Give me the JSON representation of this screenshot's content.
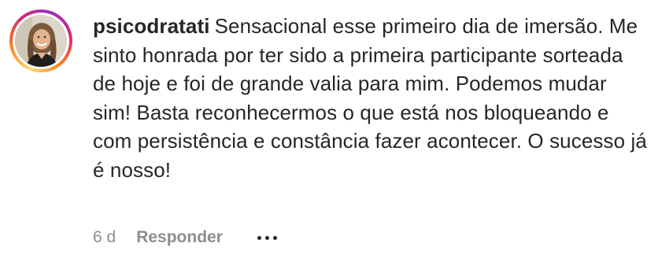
{
  "comment": {
    "username": "psicodratati",
    "text": "Sensacional esse primeiro dia de imersão. Me sinto honrada por ter sido a primeira participante sorteada de hoje e foi de grande valia para mim. Podemos mudar sim! Basta reconhecermos o que está nos bloqueando e com persistência e constância fazer acontecer. O sucesso já é nosso!",
    "time": "6 d",
    "reply_label": "Responder",
    "more_icon": "more-options-icon",
    "avatar_icon": "profile-photo"
  },
  "colors": {
    "text": "#262626",
    "secondary": "#8e8e8e",
    "story_ring": [
      "#feda75",
      "#fa7e1e",
      "#d62976",
      "#962fbf"
    ]
  }
}
